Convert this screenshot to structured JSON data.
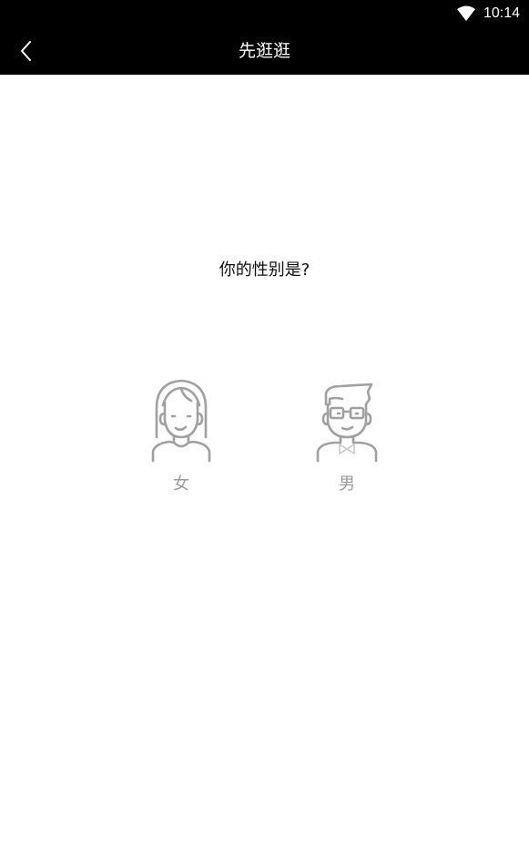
{
  "status_bar": {
    "time": "10:14",
    "icons": [
      "wifi-icon"
    ]
  },
  "header": {
    "back_icon": "chevron-left-icon",
    "title": "先逛逛"
  },
  "main": {
    "question": "你的性别是?",
    "options": [
      {
        "label": "女",
        "icon": "female-avatar-icon"
      },
      {
        "label": "男",
        "icon": "male-avatar-icon"
      }
    ]
  },
  "colors": {
    "bar_background": "#000000",
    "icon_gray": "#a0a0a0",
    "label_gray": "#9a9a9a"
  }
}
